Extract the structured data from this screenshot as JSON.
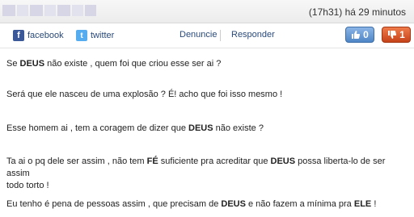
{
  "header": {
    "timestamp": "(17h31) há 29 minutos"
  },
  "share": {
    "facebook_label": "facebook",
    "twitter_label": "twitter"
  },
  "actions": {
    "denuncie_label": "Denuncie",
    "responder_label": "Responder"
  },
  "votes": {
    "up_count": "0",
    "down_count": "1"
  },
  "icons": {
    "facebook": "facebook-icon",
    "twitter": "twitter-icon",
    "thumbs_up": "thumbs-up-icon",
    "thumbs_down": "thumbs-down-icon"
  },
  "colors": {
    "vote_up": "#4f86c6",
    "vote_down": "#c7431a",
    "link": "#2a4a7a"
  },
  "comment": {
    "p1": {
      "a": "Se ",
      "b": "DEUS",
      "c": " não existe , quem foi que criou esse ser ai ?"
    },
    "p2": {
      "text": "Será que ele nasceu de uma explosão ? É! acho que foi isso mesmo !"
    },
    "p3": {
      "a": "Esse homem ai , tem a coragem de dizer que ",
      "b": "DEUS",
      "c": " não existe ?"
    },
    "p4": {
      "a": "Ta ai o pq dele ser assim , não tem ",
      "b": "FÉ",
      "c": " suficiente pra acreditar que ",
      "d": "DEUS",
      "e": " possa liberta-lo de ser assim",
      "f": "todo torto !"
    },
    "p5": {
      "a": "Eu tenho é pena de pessoas assim , que precisam de ",
      "b": "DEUS",
      "c": " e não fazem a mínima pra ",
      "d": "ELE",
      "e": " !"
    }
  }
}
